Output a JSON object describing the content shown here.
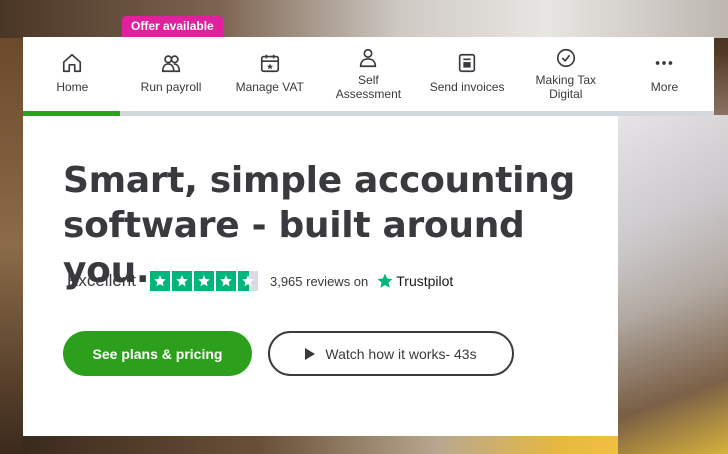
{
  "offer_badge": "Offer available",
  "nav": {
    "items": [
      {
        "label": "Home",
        "icon": "home-icon"
      },
      {
        "label": "Run payroll",
        "icon": "people-icon"
      },
      {
        "label": "Manage VAT",
        "icon": "calendar-icon"
      },
      {
        "label": "Self\nAssessment",
        "icon": "person-icon"
      },
      {
        "label": "Send invoices",
        "icon": "invoice-icon"
      },
      {
        "label": "Making Tax\nDigital",
        "icon": "checkmark-circle-icon"
      },
      {
        "label": "More",
        "icon": "more-dots-icon"
      }
    ],
    "progress": 0.14
  },
  "hero": {
    "headline": "Smart, simple accounting software - built around you.",
    "rating_word": "Excellent",
    "stars": 4.5,
    "reviews_text": "3,965 reviews on",
    "trustpilot_label": "Trustpilot",
    "primary_button": "See plans & pricing",
    "secondary_button": "Watch how it works- 43s"
  },
  "colors": {
    "accent_green": "#2ca01c",
    "badge_pink": "#e0219e",
    "trustpilot_green": "#00b67a",
    "text_dark": "#393a3d"
  }
}
